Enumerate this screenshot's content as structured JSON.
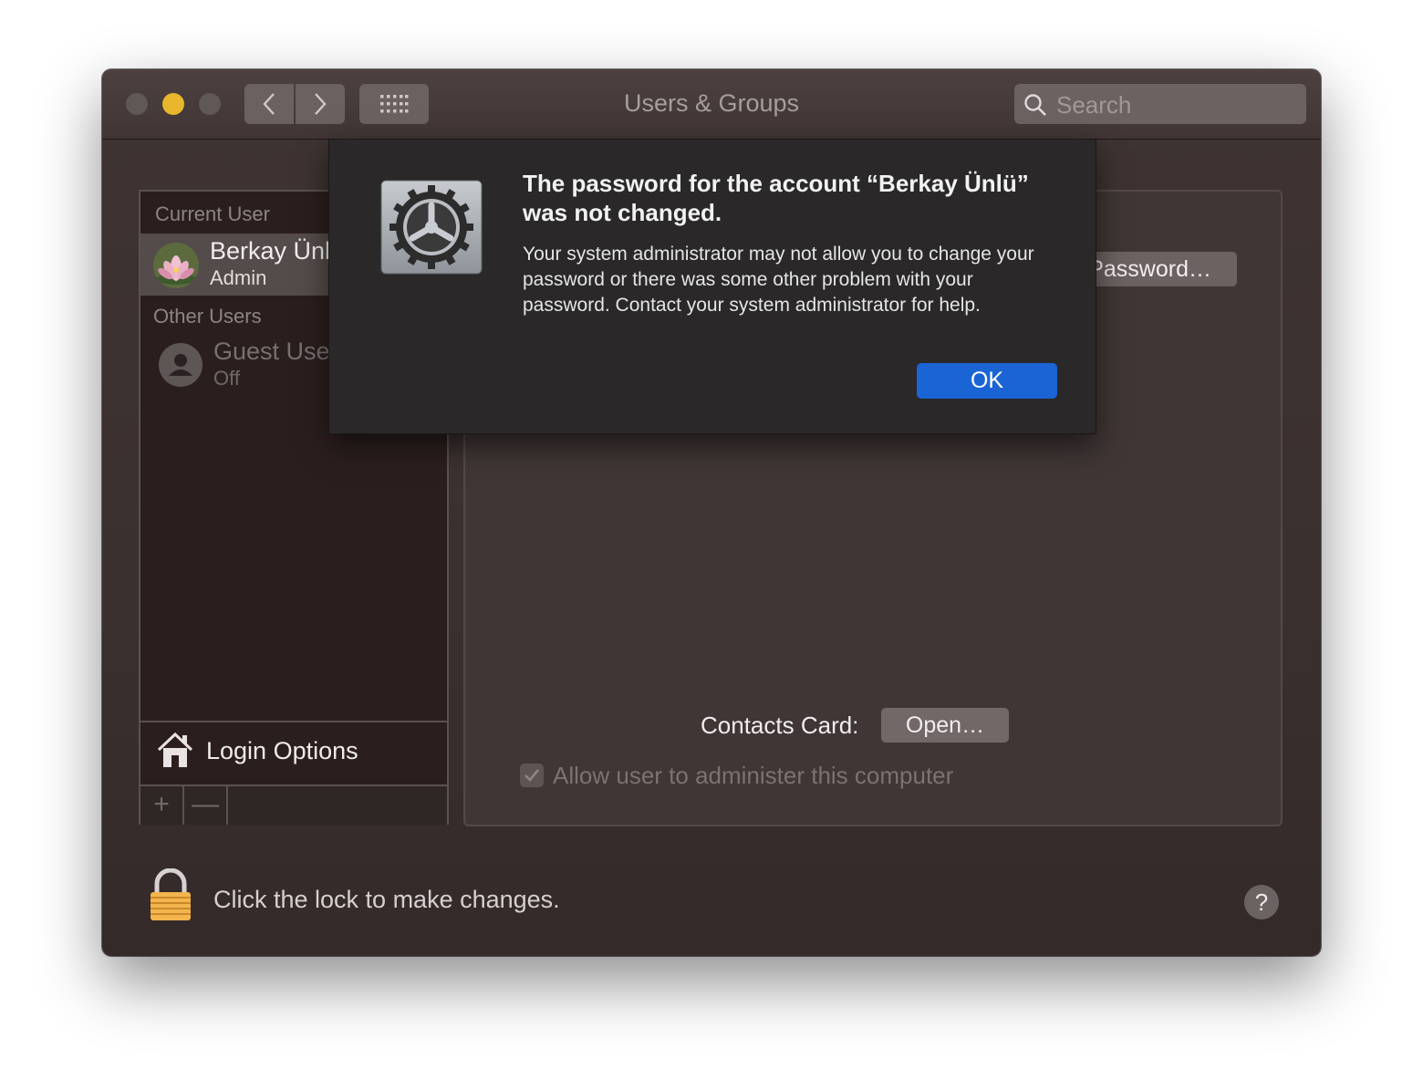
{
  "window": {
    "title": "Users & Groups"
  },
  "search": {
    "placeholder": "Search"
  },
  "sidebar": {
    "current_user_label": "Current User",
    "current_user": {
      "name": "Berkay Ünlü",
      "role": "Admin"
    },
    "other_users_label": "Other Users",
    "guest": {
      "name": "Guest User",
      "status": "Off"
    },
    "login_options": "Login Options",
    "add": "+",
    "remove": "—"
  },
  "main": {
    "change_password": "Change Password…",
    "contacts_label": "Contacts Card:",
    "open_button": "Open…",
    "allow_admin": "Allow user to administer this computer"
  },
  "footer": {
    "lock_text": "Click the lock to make changes.",
    "help": "?"
  },
  "dialog": {
    "title": "The password for the account “Berkay Ünlü” was not changed.",
    "message": "Your system administrator may not allow you to change your password or there was some other problem with your password. Contact your system administrator for help.",
    "ok": "OK"
  },
  "colors": {
    "accent": "#1a64d6",
    "minimize": "#e8b72d",
    "window_bg": "#3a302f",
    "dialog_bg": "#2a2828"
  }
}
